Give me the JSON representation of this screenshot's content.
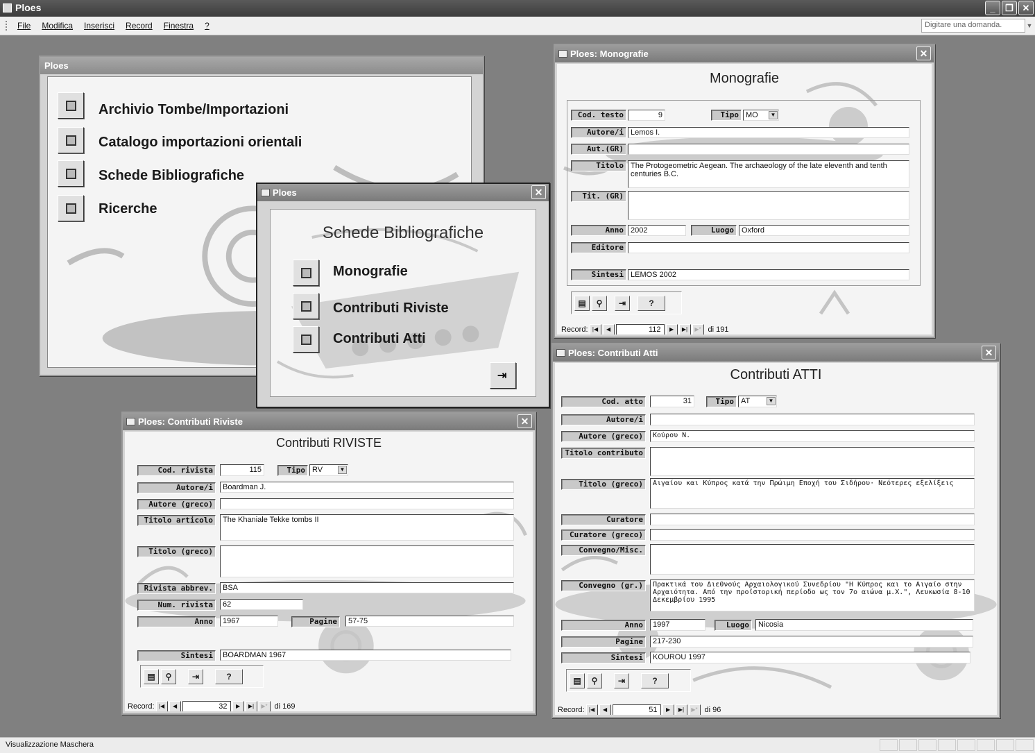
{
  "app": {
    "title": "Ploes",
    "menu": [
      "File",
      "Modifica",
      "Inserisci",
      "Record",
      "Finestra",
      "?"
    ],
    "ask_placeholder": "Digitare una domanda.",
    "status": "Visualizzazione Maschera"
  },
  "main": {
    "title": "Ploes",
    "items": [
      "Archivio Tombe/Importazioni",
      "Catalogo importazioni orientali",
      "Schede Bibliografiche",
      "Ricerche"
    ]
  },
  "schede": {
    "title": "Ploes",
    "heading": "Schede Bibliografiche",
    "items": [
      "Monografie",
      "Contributi Riviste",
      "Contributi Atti"
    ]
  },
  "monografie": {
    "title": "Ploes: Monografie",
    "heading": "Monografie",
    "labels": {
      "cod": "Cod. testo",
      "tipo": "Tipo",
      "autore": "Autore/i",
      "autgr": "Aut.(GR)",
      "titolo": "Titolo",
      "titgr": "Tit. (GR)",
      "anno": "Anno",
      "luogo": "Luogo",
      "editore": "Editore",
      "sintesi": "Sintesi"
    },
    "values": {
      "cod": "9",
      "tipo": "MO",
      "autore": "Lemos I.",
      "autgr": "",
      "titolo": "The Protogeometric Aegean. The archaeology of the late eleventh and tenth centuries B.C.",
      "titgr": "",
      "anno": "2002",
      "luogo": "Oxford",
      "editore": "",
      "sintesi": "LEMOS 2002"
    },
    "nav": {
      "label": "Record:",
      "current": "112",
      "total": "di 191"
    }
  },
  "riviste": {
    "title": "Ploes: Contributi Riviste",
    "heading": "Contributi RIVISTE",
    "labels": {
      "cod": "Cod. rivista",
      "tipo": "Tipo",
      "autore": "Autore/i",
      "autgr": "Autore (greco)",
      "titolo": "Titolo articolo",
      "titgr": "Titolo (greco)",
      "rivista": "Rivista abbrev.",
      "num": "Num. rivista",
      "anno": "Anno",
      "pagine": "Pagine",
      "sintesi": "Sintesi"
    },
    "values": {
      "cod": "115",
      "tipo": "RV",
      "autore": "Boardman J.",
      "autgr": "",
      "titolo": "The Khaniale Tekke tombs II",
      "titgr": "",
      "rivista": "BSA",
      "num": "62",
      "anno": "1967",
      "pagine": "57-75",
      "sintesi": "BOARDMAN 1967"
    },
    "nav": {
      "label": "Record:",
      "current": "32",
      "total": "di 169"
    }
  },
  "atti": {
    "title": "Ploes: Contributi Atti",
    "heading": "Contributi ATTI",
    "labels": {
      "cod": "Cod. atto",
      "tipo": "Tipo",
      "autore": "Autore/i",
      "autgr": "Autore (greco)",
      "titolo": "Titolo contributo",
      "titgr": "Titolo (greco)",
      "curatore": "Curatore",
      "curgr": "Curatore (greco)",
      "convegno": "Convegno/Misc.",
      "convgr": "Convegno (gr.)",
      "anno": "Anno",
      "luogo": "Luogo",
      "pagine": "Pagine",
      "sintesi": "Sintesi"
    },
    "values": {
      "cod": "31",
      "tipo": "AT",
      "autore": "",
      "autgr": "Κούρου Ν.",
      "titolo": "",
      "titgr": "Αιγαίου και Κύπρος κατά την Πρώιμη Εποχή του Σιδήρου· Νεότερες εξελίξεις",
      "curatore": "",
      "curgr": "",
      "convegno": "",
      "convgr": "Πρακτικά του Διεθνούς Αρχαιολογικού Συνεδρίου \"Η Κύπρος και το Αιγαίο στην Αρχαιότητα. Από την προϊστορική περίοδο ως τον 7ο αιώνα μ.Χ.\", Λευκωσία 8-10 Δεκεμβρίου 1995",
      "anno": "1997",
      "luogo": "Nicosia",
      "pagine": "217-230",
      "sintesi": "KOUROU 1997"
    },
    "nav": {
      "label": "Record:",
      "current": "51",
      "total": "di 96"
    }
  }
}
